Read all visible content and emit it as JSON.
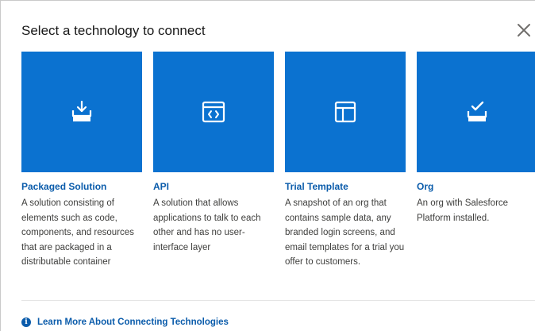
{
  "modal": {
    "title": "Select a technology to connect",
    "close_icon": "close-icon"
  },
  "cards": [
    {
      "icon": "download-to-tray-icon",
      "title": "Packaged Solution",
      "description": "A solution consisting of elements such as code, components, and resources that are packaged in a distributable container"
    },
    {
      "icon": "code-window-icon",
      "title": "API",
      "description": "A solution that allows applications to talk to each other and has no user-interface layer"
    },
    {
      "icon": "template-layout-icon",
      "title": "Trial Template",
      "description": "A snapshot of an org that contains sample data, any branded login screens, and email templates for a trial you offer to customers."
    },
    {
      "icon": "tray-check-icon",
      "title": "Org",
      "description": "An org with Salesforce Platform installed."
    }
  ],
  "footer": {
    "icon": "info-icon",
    "link_label": "Learn More About Connecting Technologies"
  },
  "colors": {
    "tile": "#0b72d0",
    "link": "#0b5cab"
  }
}
